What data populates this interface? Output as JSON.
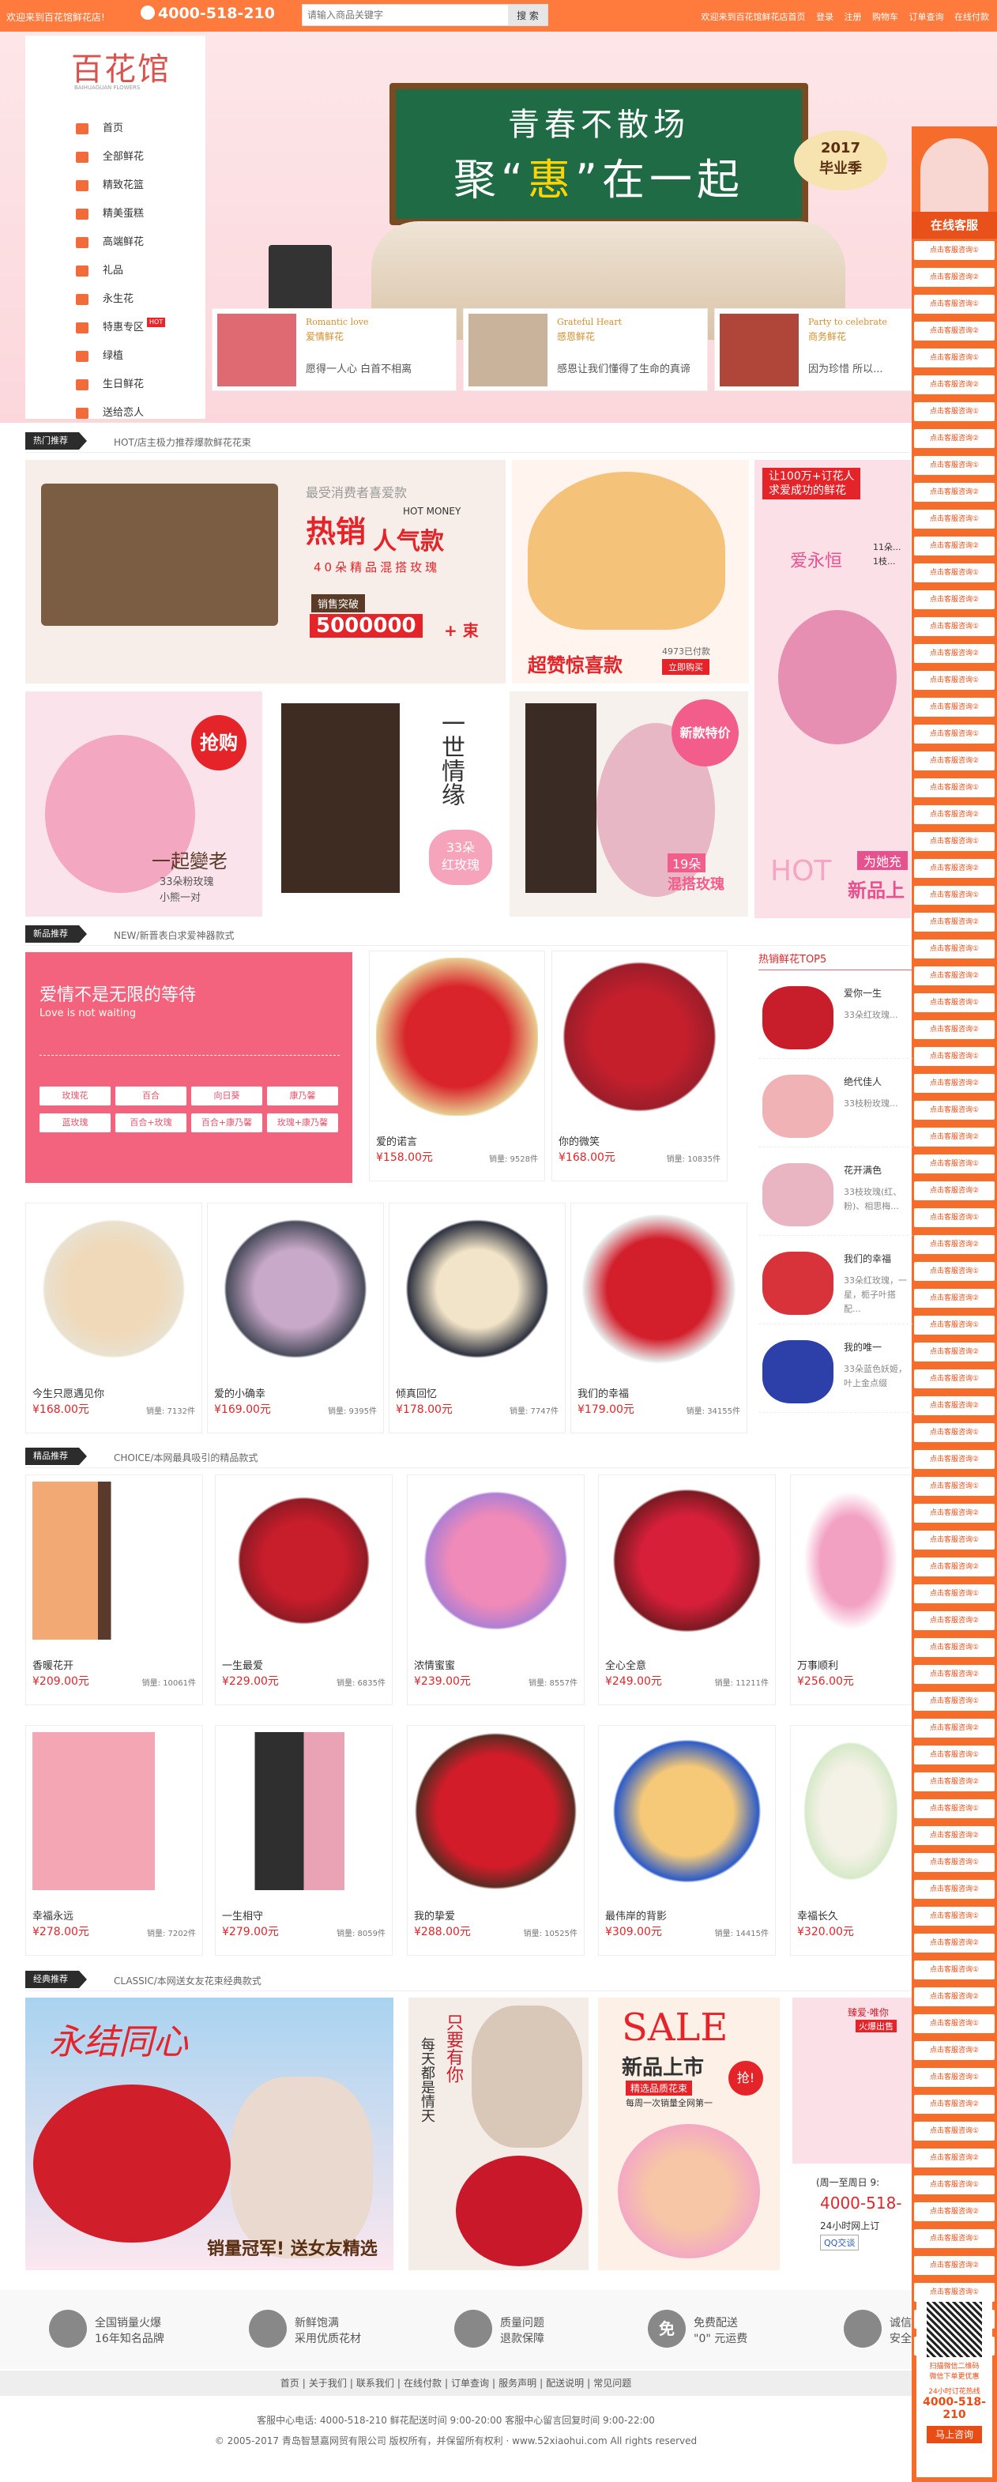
{
  "topbar": {
    "welcome": "欢迎来到百花馆鲜花店!",
    "phone": "4000-518-210",
    "search_placeholder": "请输入商品关键字",
    "search_button": "搜 索",
    "links": [
      "欢迎来到百花馆鲜花店首页",
      "登录",
      "注册",
      "购物车",
      "订单查询",
      "在线付款"
    ]
  },
  "logo": {
    "text": "百花馆",
    "sub": "BAIHUAGUAN FLOWERS"
  },
  "nav": [
    {
      "label": "首页",
      "icon": "home-icon"
    },
    {
      "label": "全部鲜花",
      "icon": "list-icon"
    },
    {
      "label": "精致花篮",
      "icon": "basket-icon"
    },
    {
      "label": "精美蛋糕",
      "icon": "cake-icon"
    },
    {
      "label": "高端鲜花",
      "icon": "flower-icon"
    },
    {
      "label": "礼品",
      "icon": "gift-icon"
    },
    {
      "label": "永生花",
      "icon": "star-icon"
    },
    {
      "label": "特惠专区",
      "icon": "tag-icon",
      "hot": "HOT"
    },
    {
      "label": "绿植",
      "icon": "plant-icon"
    },
    {
      "label": "生日鲜花",
      "icon": "birthday-icon"
    },
    {
      "label": "送给恋人",
      "icon": "heart-icon"
    }
  ],
  "banner": {
    "line1": "青春不散场",
    "line2a": "聚“",
    "line2b": "惠",
    "line2c": "”在一起",
    "badge_year": "2017",
    "badge_text": "毕业季"
  },
  "banner_cards": [
    {
      "en": "Romantic love",
      "cn": "爱情鲜花",
      "desc": "愿得一人心  白首不相离"
    },
    {
      "en": "Grateful Heart",
      "cn": "感恩鲜花",
      "desc": "感恩让我们懂得了生命的真谛"
    },
    {
      "en": "Party to celebrate",
      "cn": "商务鲜花",
      "desc": "因为珍惜  所以..."
    }
  ],
  "right_panel": {
    "online": "在线客服",
    "items": [
      "点击客服咨询①",
      "点击客服咨询②",
      "点击客服咨询①",
      "点击客服咨询②",
      "点击客服咨询①",
      "点击客服咨询②",
      "点击客服咨询①",
      "点击客服咨询②",
      "点击客服咨询①",
      "点击客服咨询②",
      "点击客服咨询①",
      "点击客服咨询②",
      "点击客服咨询①",
      "点击客服咨询②",
      "点击客服咨询①",
      "点击客服咨询②",
      "点击客服咨询①",
      "点击客服咨询②",
      "点击客服咨询①",
      "点击客服咨询②",
      "点击客服咨询①",
      "点击客服咨询②",
      "点击客服咨询①",
      "点击客服咨询②",
      "点击客服咨询①",
      "点击客服咨询②",
      "点击客服咨询①",
      "点击客服咨询②",
      "点击客服咨询①",
      "点击客服咨询②",
      "点击客服咨询①",
      "点击客服咨询②",
      "点击客服咨询①",
      "点击客服咨询②",
      "点击客服咨询①",
      "点击客服咨询②",
      "点击客服咨询①",
      "点击客服咨询②",
      "点击客服咨询①",
      "点击客服咨询②",
      "点击客服咨询①",
      "点击客服咨询②",
      "点击客服咨询①",
      "点击客服咨询②",
      "点击客服咨询①",
      "点击客服咨询②",
      "点击客服咨询①",
      "点击客服咨询②",
      "点击客服咨询①",
      "点击客服咨询②",
      "点击客服咨询①",
      "点击客服咨询②",
      "点击客服咨询①",
      "点击客服咨询②",
      "点击客服咨询①",
      "点击客服咨询②",
      "点击客服咨询①",
      "点击客服咨询②",
      "点击客服咨询①",
      "点击客服咨询②",
      "点击客服咨询①",
      "点击客服咨询②",
      "点击客服咨询①",
      "点击客服咨询②",
      "点击客服咨询①",
      "点击客服咨询②",
      "点击客服咨询①",
      "点击客服咨询②",
      "点击客服咨询①",
      "点击客服咨询②",
      "点击客服咨询①",
      "点击客服咨询②",
      "点击客服咨询①",
      "点击客服咨询②",
      "点击客服咨询①",
      "点击客服咨询②",
      "点击客服咨询①",
      "点击客服咨询②",
      "点击客服咨询①"
    ],
    "qr_text1": "扫描微信二维码",
    "qr_text2": "微信下单更优惠",
    "hotline_label": "24小时订花热线",
    "hotline": "4000-518-210",
    "consult": "马上咨询"
  },
  "sections": {
    "hot": {
      "tag": "热门推荐",
      "sub": "HOT/店主极力推荐爆款鲜花花束"
    },
    "new": {
      "tag": "新品推荐",
      "sub": "NEW/新晋表白求爱神器款式"
    },
    "choice": {
      "tag": "精品推荐",
      "sub": "CHOICE/本网最具吸引的精品款式"
    },
    "classic": {
      "tag": "经典推荐",
      "sub": "CLASSIC/本网送女友花束经典款式"
    }
  },
  "hot_ads": {
    "a1_top": "最受消费者喜爱款",
    "a1_big1": "热销",
    "a1_big2": "人气款",
    "a1_money": "HOT MONEY",
    "a1_desc": "40朵精品混搭玫瑰",
    "a1_sales_label": "销售突破",
    "a1_sales": "5000000",
    "a1_unit": "+ 束",
    "a2_text": "超赞惊喜款",
    "a2_sold": "4973已付款",
    "a2_btn": "立即购买",
    "a3_top1": "让100万+订花人",
    "a3_top2": "求爱成功的鲜花",
    "a3_name": "爱永恒",
    "a3_l1": "11朵...",
    "a3_l2": "1枝...",
    "a3_bottom1": "为她充",
    "a3_bottom2": "新品上",
    "a3_hot": "HOT",
    "b1_tag": "抢购",
    "b1_title": "一起變老",
    "b1_d1": "33朵粉玫瑰",
    "b1_d2": "小熊一对",
    "b2_title": "一世情缘",
    "b2_num": "33朵",
    "b2_label": "红玫瑰",
    "b3_tag": "新款特价",
    "b3_num": "19朵",
    "b3_label": "混搭玫瑰"
  },
  "love": {
    "title": "爱情不是无限的等待",
    "en": "Love is not waiting",
    "chips": [
      "玫瑰花",
      "百合",
      "向日葵",
      "康乃馨",
      "蓝玫瑰",
      "百合+玫瑰",
      "百合+康乃馨",
      "玫瑰+康乃馨"
    ]
  },
  "new_products_top": [
    {
      "name": "爱的诺言",
      "price": "¥158.00元",
      "sales": "销量: 9528件"
    },
    {
      "name": "你的微笑",
      "price": "¥168.00元",
      "sales": "销量: 10835件"
    }
  ],
  "new_products_row": [
    {
      "name": "今生只愿遇见你",
      "price": "¥168.00元",
      "sales": "销量: 7132件"
    },
    {
      "name": "爱的小确幸",
      "price": "¥169.00元",
      "sales": "销量: 9395件"
    },
    {
      "name": "倾真回忆",
      "price": "¥178.00元",
      "sales": "销量: 7747件"
    },
    {
      "name": "我们的幸福",
      "price": "¥179.00元",
      "sales": "销量: 34155件"
    }
  ],
  "hot_list": {
    "title": "热销鲜花TOP5",
    "items": [
      {
        "name": "爱你一生",
        "desc": "33朵红玫瑰..."
      },
      {
        "name": "绝代佳人",
        "desc": "33枝粉玫瑰..."
      },
      {
        "name": "花开满色",
        "desc": "33枝玫瑰(红、粉)、相思梅..."
      },
      {
        "name": "我们的幸福",
        "desc": "33朵红玫瑰，一星，栀子叶搭配..."
      },
      {
        "name": "我的唯一",
        "desc": "33朵蓝色妖姬，叶上金点缀"
      }
    ]
  },
  "choice_row1": [
    {
      "name": "香暖花开",
      "price": "¥209.00元",
      "sales": "销量: 10061件"
    },
    {
      "name": "一生最爱",
      "price": "¥229.00元",
      "sales": "销量: 6835件"
    },
    {
      "name": "浓情蜜蜜",
      "price": "¥239.00元",
      "sales": "销量: 8557件"
    },
    {
      "name": "全心全意",
      "price": "¥249.00元",
      "sales": "销量: 11211件"
    },
    {
      "name": "万事顺利",
      "price": "¥256.00元",
      "sales": ""
    }
  ],
  "choice_row2": [
    {
      "name": "幸福永远",
      "price": "¥278.00元",
      "sales": "销量: 7202件"
    },
    {
      "name": "一生相守",
      "price": "¥279.00元",
      "sales": "销量: 8059件"
    },
    {
      "name": "我的挚爱",
      "price": "¥288.00元",
      "sales": "销量: 10525件"
    },
    {
      "name": "最伟岸的背影",
      "price": "¥309.00元",
      "sales": "销量: 14415件"
    },
    {
      "name": "幸福长久",
      "price": "¥320.00元",
      "sales": ""
    }
  ],
  "classic": {
    "c1_title": "永结同心",
    "c1_bottom": "销量冠军! 送女友精选",
    "c2_l1": "只要有你",
    "c2_l2": "每天都是情天",
    "c3_sale": "SALE",
    "c3_new": "新品上市",
    "c3_sub1": "精选品质花束",
    "c3_sub2": "每周一次销量全网第一",
    "c3_tag": "抢!",
    "c4_top": "臻爱·唯你",
    "c4_sub": "火爆出售",
    "c4_service": "(周一至周日 9:",
    "c4_phone": "4000-518-",
    "c4_online": "24小时网上订",
    "c4_qq": "QQ交谈"
  },
  "features": [
    {
      "icon": "house-icon",
      "t1": "全国销量火爆",
      "t2": "16年知名品牌",
      "glyph": ""
    },
    {
      "icon": "flower-bloom-icon",
      "t1": "新鲜饱满",
      "t2": "采用优质花材",
      "glyph": ""
    },
    {
      "icon": "diamond-icon",
      "t1": "质量问题",
      "t2": "退款保障",
      "glyph": ""
    },
    {
      "icon": "free-icon",
      "t1": "免费配送",
      "t2": "\"0\" 元运费",
      "glyph": "免"
    },
    {
      "icon": "handshake-icon",
      "t1": "诚信",
      "t2": "安全",
      "glyph": ""
    }
  ],
  "footer": {
    "links": [
      "首页",
      "关于我们",
      "联系我们",
      "在线付款",
      "订单查询",
      "服务声明",
      "配送说明",
      "常见问题"
    ],
    "line1": "客服中心电话: 4000-518-210 鲜花配送时间 9:00-20:00 客服中心留言回复时间 9:00-22:00",
    "line2": "© 2005-2017 青岛智慧嘉网贸有限公司 版权所有，并保留所有权利 · www.52xiaohui.com All rights reserved"
  },
  "colors": {
    "accent": "#ff7a3d",
    "price": "#e5242a",
    "pink": "#f4637d",
    "side_orange": "#f66c2a"
  }
}
